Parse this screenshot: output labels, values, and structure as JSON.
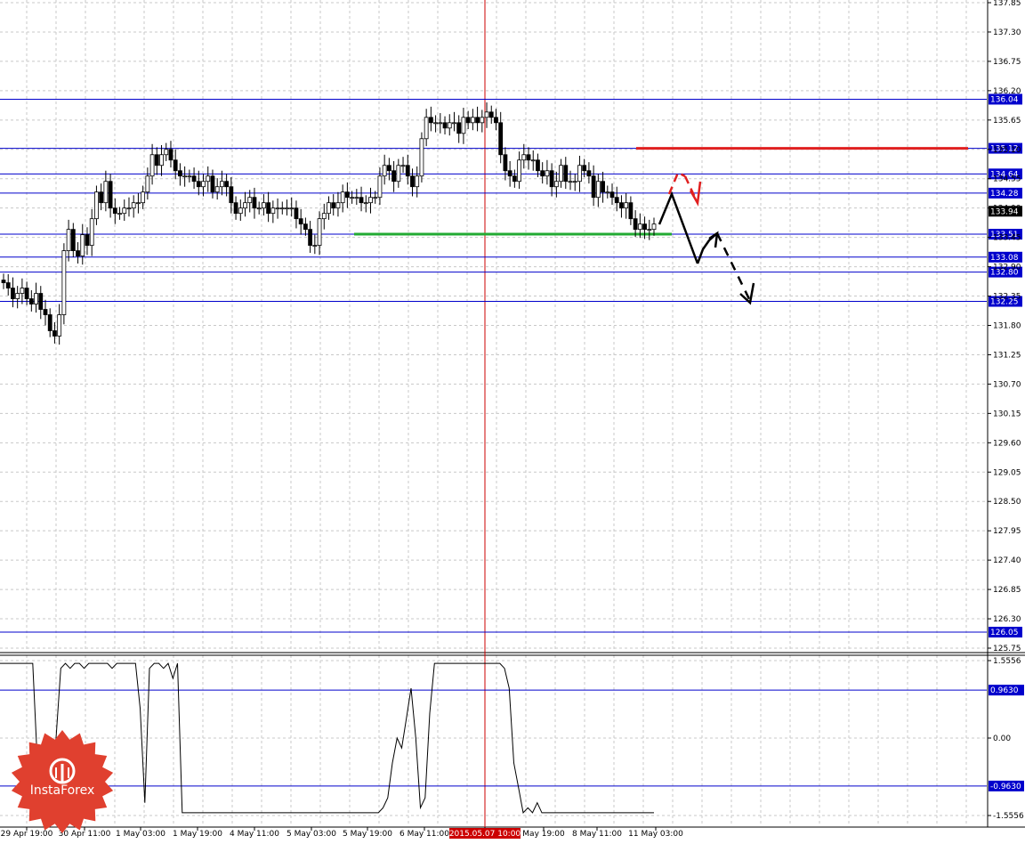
{
  "chart_data": [
    {
      "type": "candlestick",
      "panel": "price",
      "ylim": [
        125.75,
        137.85
      ],
      "y_ticks": [
        "137.85",
        "137.30",
        "136.75",
        "136.20",
        "135.65",
        "135.10",
        "134.55",
        "134.00",
        "133.45",
        "132.90",
        "132.35",
        "131.80",
        "131.25",
        "130.70",
        "130.15",
        "129.60",
        "129.05",
        "128.50",
        "127.95",
        "127.40",
        "126.85",
        "126.30",
        "125.75"
      ],
      "x_ticks": [
        "29 Apr 19:00",
        "30 Apr 11:00",
        "1 May 03:00",
        "1 May 19:00",
        "4 May 11:00",
        "5 May 03:00",
        "5 May 19:00",
        "6 May 11:00",
        "2015.05.07 10:00",
        "May 19:00",
        "8 May 11:00",
        "11 May 03:00"
      ],
      "current_price": "133.94",
      "level_lines": [
        {
          "value": 136.04,
          "label": "136.04"
        },
        {
          "value": 135.12,
          "label": "135.12"
        },
        {
          "value": 134.64,
          "label": "134.64"
        },
        {
          "value": 134.28,
          "label": "134.28"
        },
        {
          "value": 133.51,
          "label": "133.51"
        },
        {
          "value": 133.08,
          "label": "133.08"
        },
        {
          "value": 132.8,
          "label": "132.80"
        },
        {
          "value": 132.25,
          "label": "132.25"
        },
        {
          "value": 126.05,
          "label": "126.05"
        }
      ],
      "resistance_line": {
        "value": 135.12,
        "color": "#e02020"
      },
      "support_line": {
        "value": 133.51,
        "color": "#22aa33"
      },
      "selected_bar_label": "2015.05.07 10:00",
      "series": [
        {
          "values": [
            132.6,
            132.5,
            132.3,
            132.4,
            132.5,
            132.3,
            132.2,
            132.4,
            132.1,
            132.0,
            131.7,
            131.6,
            132.0,
            133.2,
            133.6,
            133.2,
            133.1,
            133.5,
            133.3,
            133.8,
            134.3,
            134.1,
            134.5,
            134.0,
            133.9,
            133.9,
            134.0,
            134.0,
            134.1,
            134.1,
            134.3,
            134.6,
            135.0,
            134.8,
            135.0,
            135.1,
            134.9,
            134.7,
            134.6,
            134.6,
            134.6,
            134.5,
            134.4,
            134.5,
            134.6,
            134.3,
            134.4,
            134.5,
            134.4,
            134.1,
            133.9,
            134.0,
            134.1,
            134.2,
            134.0,
            134.0,
            134.1,
            133.9,
            134.0,
            134.0,
            134.0,
            134.0,
            134.0,
            133.8,
            133.7,
            133.6,
            133.3,
            133.3,
            133.8,
            133.9,
            134.1,
            134.0,
            134.1,
            134.3,
            134.2,
            134.2,
            134.2,
            134.1,
            134.1,
            134.2,
            134.2,
            134.6,
            134.8,
            134.7,
            134.5,
            134.8,
            134.8,
            134.6,
            134.4,
            134.6,
            135.3,
            135.7,
            135.6,
            135.6,
            135.6,
            135.5,
            135.6,
            135.6,
            135.4,
            135.7,
            135.6,
            135.7,
            135.6,
            135.7,
            135.8,
            135.7,
            135.6,
            135.0,
            134.7,
            134.6,
            134.5,
            134.9,
            135.0,
            134.9,
            134.9,
            134.7,
            134.6,
            134.7,
            134.4,
            134.5,
            134.8,
            134.5,
            134.5,
            134.5,
            134.8,
            134.7,
            134.6,
            134.2,
            134.5,
            134.3,
            134.3,
            134.2,
            134.1,
            134.0,
            134.1,
            133.8,
            133.6,
            133.7,
            133.6,
            133.6,
            133.7
          ]
        }
      ]
    },
    {
      "type": "line",
      "panel": "indicator",
      "ylim": [
        -1.5556,
        1.5556
      ],
      "y_ticks": [
        "1.5556",
        "0.00",
        "-1.5556"
      ],
      "level_lines": [
        {
          "value": 0.963,
          "label": "0.9630"
        },
        {
          "value": -0.963,
          "label": "-0.9630"
        }
      ],
      "series": [
        {
          "values": [
            1.5,
            1.5,
            1.5,
            1.5,
            1.5,
            1.5,
            1.5,
            1.5,
            -0.5,
            -1.5,
            -1.5,
            -1.2,
            0.0,
            1.4,
            1.5,
            1.4,
            1.5,
            1.5,
            1.4,
            1.5,
            1.5,
            1.5,
            1.5,
            1.5,
            1.4,
            1.5,
            1.5,
            1.5,
            1.5,
            1.5,
            0.6,
            -1.3,
            1.4,
            1.5,
            1.5,
            1.4,
            1.5,
            1.2,
            1.5,
            -1.5,
            -1.5,
            -1.5,
            -1.5,
            -1.5,
            -1.5,
            -1.5,
            -1.5,
            -1.5,
            -1.5,
            -1.5,
            -1.5,
            -1.5,
            -1.5,
            -1.5,
            -1.5,
            -1.5,
            -1.5,
            -1.5,
            -1.5,
            -1.5,
            -1.5,
            -1.5,
            -1.5,
            -1.5,
            -1.5,
            -1.5,
            -1.5,
            -1.5,
            -1.5,
            -1.5,
            -1.5,
            -1.5,
            -1.5,
            -1.5,
            -1.5,
            -1.5,
            -1.5,
            -1.5,
            -1.5,
            -1.5,
            -1.5,
            -1.5,
            -1.4,
            -1.2,
            -0.5,
            0.0,
            -0.2,
            0.4,
            1.0,
            0.0,
            -1.4,
            -1.2,
            0.5,
            1.5,
            1.5,
            1.5,
            1.5,
            1.5,
            1.5,
            1.5,
            1.5,
            1.5,
            1.5,
            1.5,
            1.5,
            1.5,
            1.5,
            1.5,
            1.4,
            1.0,
            -0.5,
            -1.0,
            -1.5,
            -1.4,
            -1.5,
            -1.3,
            -1.5,
            -1.5,
            -1.5,
            -1.5,
            -1.5,
            -1.5,
            -1.5,
            -1.5,
            -1.5,
            -1.5,
            -1.5,
            -1.5,
            -1.5,
            -1.5,
            -1.5,
            -1.5,
            -1.5,
            -1.5,
            -1.5,
            -1.5,
            -1.5,
            -1.5,
            -1.5,
            -1.5,
            -1.5
          ]
        }
      ]
    }
  ],
  "logo_text": "InstaForex",
  "colors": {
    "level_line": "#0000cc",
    "grid": "#c8c8c8",
    "resistance": "#e02020",
    "support": "#22aa33",
    "vertical_marker": "#cc0000",
    "logo": "#e0402f"
  },
  "icons": {
    "logo": "instaforex-logo-icon"
  }
}
